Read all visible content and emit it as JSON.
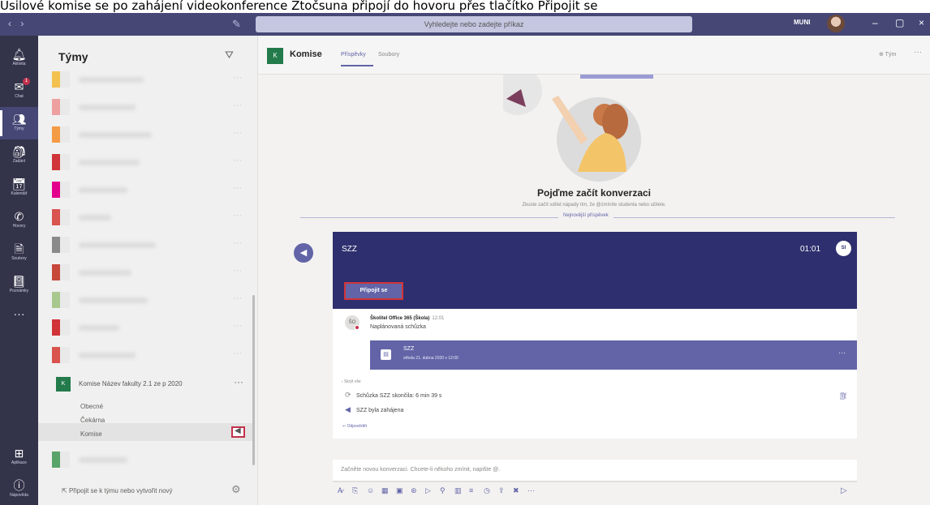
{
  "caption": "Úsilové komise se po zahájení videokonference Ztočsuna připojí do hovoru přes tlačítko Připojit se",
  "titlebar": {
    "nav": "‹ ›",
    "search_placeholder": "Vyhledejte nebo zadejte příkaz",
    "user_name": "MUNI",
    "minimize": "–",
    "maximize": "▢",
    "close": "×"
  },
  "rail": [
    {
      "label": "Aktivita",
      "icon": "bell-icon",
      "glyph": "🔔︎"
    },
    {
      "label": "Chat",
      "icon": "chat-icon",
      "glyph": "✉",
      "badge": "1"
    },
    {
      "label": "Týmy",
      "icon": "teams-icon",
      "glyph": "👥︎",
      "active": true
    },
    {
      "label": "Zadání",
      "icon": "assignments-icon",
      "glyph": "🎒︎"
    },
    {
      "label": "Kalendář",
      "icon": "calendar-icon",
      "glyph": "📅︎"
    },
    {
      "label": "Hovory",
      "icon": "calls-icon",
      "glyph": "✆"
    },
    {
      "label": "Soubory",
      "icon": "files-icon",
      "glyph": "🗎"
    },
    {
      "label": "Poznámky",
      "icon": "notes-icon",
      "glyph": "📓︎"
    },
    {
      "label": "",
      "icon": "more-apps-icon",
      "glyph": "···"
    }
  ],
  "rail_bottom": [
    {
      "label": "Aplikace",
      "icon": "apps-icon",
      "glyph": "⊞"
    },
    {
      "label": "Nápověda",
      "icon": "help-icon",
      "glyph": "ⓘ"
    }
  ],
  "teams_panel": {
    "title": "Týmy",
    "blurred_teams": [
      {
        "color": "#f2c14e"
      },
      {
        "color": "#eea0a0"
      },
      {
        "color": "#f49b46"
      },
      {
        "color": "#d13438"
      },
      {
        "color": "#e3008c"
      },
      {
        "color": "#d9534f"
      },
      {
        "color": "#8a8a8a"
      },
      {
        "color": "#c8473b"
      },
      {
        "color": "#a9c88f"
      },
      {
        "color": "#d13438"
      },
      {
        "color": "#d9534f"
      }
    ],
    "komise_team": {
      "tile": "K",
      "name": "Komise Název fakulty 2.1 ze p 2020",
      "more": "···",
      "channels": [
        "Obecné",
        "Čekárna",
        "Komise"
      ]
    },
    "last_team_color": "#5aa469",
    "join_label": "Připojit se k týmu nebo vytvořit nový"
  },
  "channel": {
    "tile": "K",
    "name": "Komise",
    "tabs": [
      "Příspěvky",
      "Soubory"
    ],
    "team_button": "⊕ Tým",
    "more": "···"
  },
  "conversation": {
    "title": "Pojďme začít konverzaci",
    "subtitle": "Zkuste začít sdílet nápady tím, že @zmíníte studenta nebo učitele.",
    "divider": "Nejnovější příspěvek"
  },
  "meeting": {
    "title": "SZZ",
    "time": "01:01",
    "host_initials": "SI",
    "join_button": "Připojit se"
  },
  "thread": {
    "avatar": "ŠO",
    "sender": "Školitel Office 365 (Škola)",
    "sender_time": "12:01",
    "subtitle": "Naplánovaná schůzka",
    "inner_title": "SZZ",
    "inner_date": "středa 21. dubna 2020 v 12:00",
    "collapse": "‹ Skrýt vše",
    "line1": "Schůzka SZZ skončila: 6 min 39 s",
    "line2": "SZZ byla zahájena",
    "reply": "↩ Odpovědět"
  },
  "composer": {
    "placeholder": "Začněte novou konverzaci. Chcete-li někoho zmínit, napište @."
  },
  "toolbar_glyphs": [
    "A̷",
    "⎘",
    "☺",
    "▦",
    "▣",
    "⊛",
    "▷",
    "⚲",
    "▥",
    "≡",
    "◷",
    "⇪",
    "✖",
    "···"
  ],
  "send_glyph": "▷"
}
